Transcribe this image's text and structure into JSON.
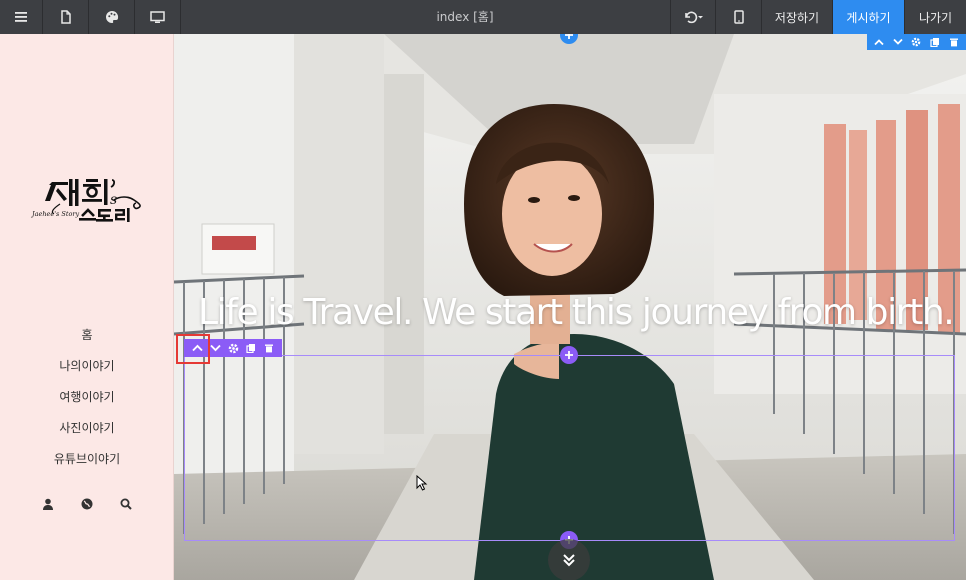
{
  "toolbar": {
    "page_title": "index [홈]",
    "save_label": "저장하기",
    "publish_label": "게시하기",
    "exit_label": "나가기",
    "left_icons": [
      "menu-icon",
      "page-icon",
      "palette-icon",
      "desktop-icon"
    ],
    "right_icons": [
      "undo-icon",
      "mobile-icon"
    ],
    "accent_color": "#2e8cf0"
  },
  "sidebar": {
    "background_color": "#fce8e6",
    "logo_alt": "재희's 스토리 (Jaehee's Story)",
    "nav": [
      {
        "label": "홈"
      },
      {
        "label": "나의이야기"
      },
      {
        "label": "여행이야기"
      },
      {
        "label": "사진이야기"
      },
      {
        "label": "유튜브이야기"
      }
    ],
    "icons": [
      "user-icon",
      "globe-icon",
      "search-icon"
    ]
  },
  "hero": {
    "headline": "Life is Travel. We start this journey from birth.",
    "section_toolbar_icons": [
      "move-up-icon",
      "move-down-icon",
      "settings-icon",
      "copy-icon",
      "delete-icon"
    ],
    "row_toolbar_icons": [
      "move-up-icon",
      "move-down-icon",
      "settings-icon",
      "copy-icon",
      "delete-icon"
    ],
    "row_color": "#8b5cf6",
    "scroll_icon": "double-chevron-down-icon"
  }
}
